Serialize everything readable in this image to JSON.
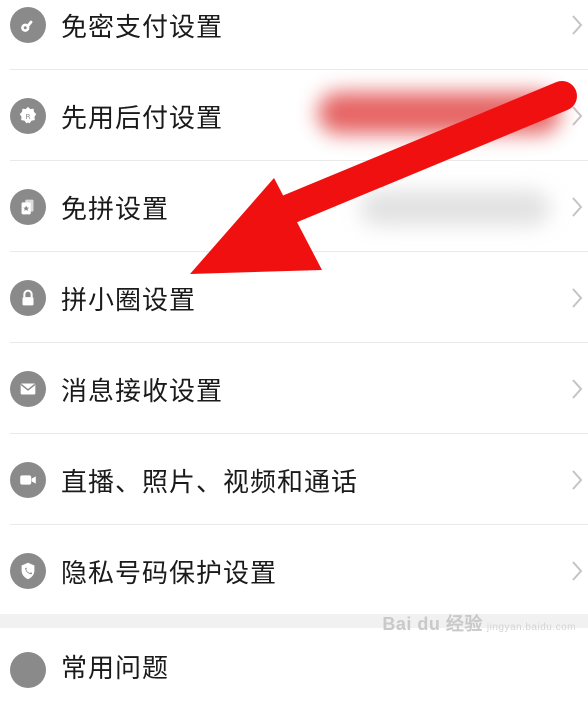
{
  "settings": {
    "items": [
      {
        "label": "免密支付设置",
        "icon": "key-icon"
      },
      {
        "label": "先用后付设置",
        "icon": "badge-icon"
      },
      {
        "label": "免拼设置",
        "icon": "cards-icon"
      },
      {
        "label": "拼小圈设置",
        "icon": "lock-icon"
      },
      {
        "label": "消息接收设置",
        "icon": "mail-icon"
      },
      {
        "label": "直播、照片、视频和通话",
        "icon": "video-icon"
      },
      {
        "label": "隐私号码保护设置",
        "icon": "shield-phone-icon"
      },
      {
        "label": "常用问题",
        "icon": "help-icon"
      }
    ]
  },
  "annotation": {
    "arrow_color": "#f01010",
    "points_to": "拼小圈设置"
  },
  "watermark": {
    "text": "Bai du 经验",
    "sub": "jingyan.baidu.com"
  },
  "colors": {
    "icon_bg": "#8a8a8a",
    "text": "#1a1a1a",
    "divider": "#e9e9e9",
    "section_gap": "#f1f1f1"
  }
}
